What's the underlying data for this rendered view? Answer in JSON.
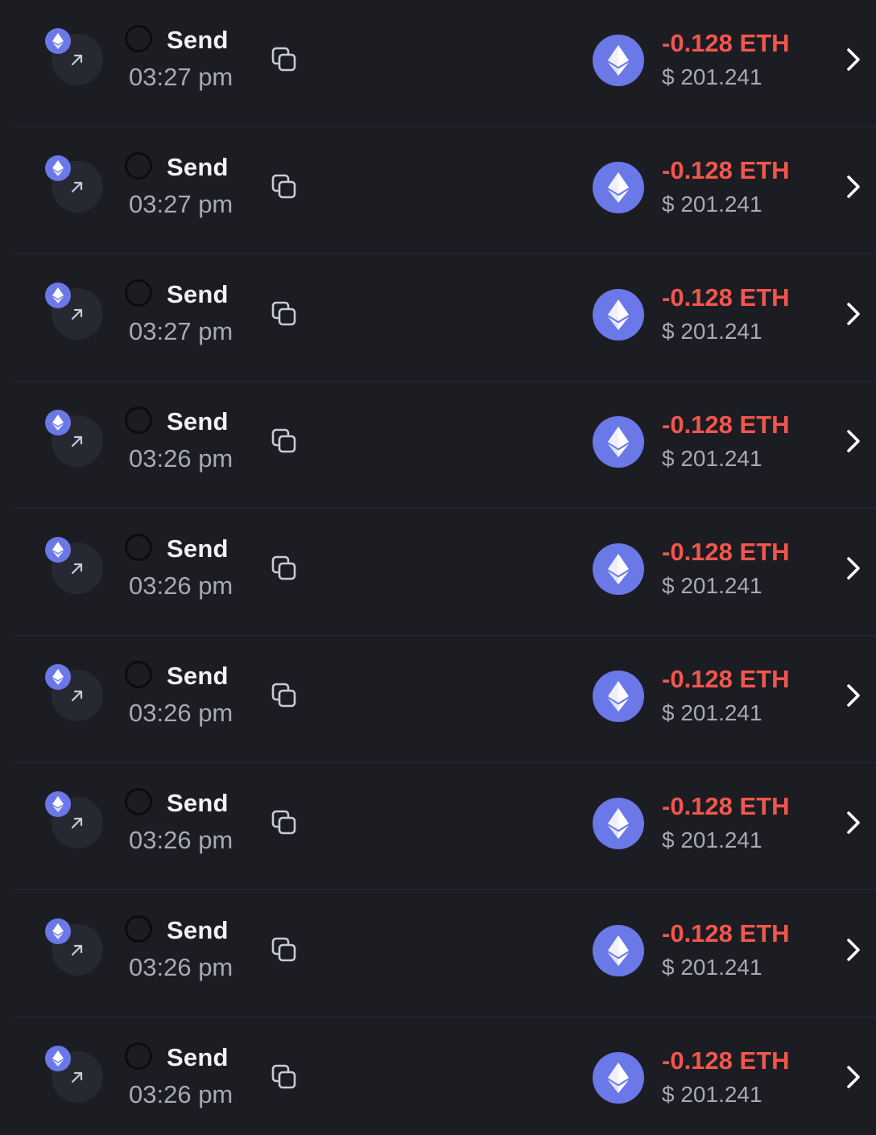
{
  "colors": {
    "background": "#1c1d23",
    "divider": "#262a36",
    "eth_blue": "#6a78e8",
    "negative_amount": "#f2564d",
    "muted_text": "#a7a9b3",
    "primary_text": "#f2f2f5"
  },
  "icons": {
    "direction": "arrow-up-right-icon",
    "chain": "ethereum-icon",
    "copy": "copy-icon",
    "status": "status-circle-icon",
    "navigate": "chevron-right-icon"
  },
  "transactions": [
    {
      "type": "Send",
      "time": "03:27 pm",
      "amount": "-0.128 ETH",
      "fiat": "$ 201.241"
    },
    {
      "type": "Send",
      "time": "03:27 pm",
      "amount": "-0.128 ETH",
      "fiat": "$ 201.241"
    },
    {
      "type": "Send",
      "time": "03:27 pm",
      "amount": "-0.128 ETH",
      "fiat": "$ 201.241"
    },
    {
      "type": "Send",
      "time": "03:26 pm",
      "amount": "-0.128 ETH",
      "fiat": "$ 201.241"
    },
    {
      "type": "Send",
      "time": "03:26 pm",
      "amount": "-0.128 ETH",
      "fiat": "$ 201.241"
    },
    {
      "type": "Send",
      "time": "03:26 pm",
      "amount": "-0.128 ETH",
      "fiat": "$ 201.241"
    },
    {
      "type": "Send",
      "time": "03:26 pm",
      "amount": "-0.128 ETH",
      "fiat": "$ 201.241"
    },
    {
      "type": "Send",
      "time": "03:26 pm",
      "amount": "-0.128 ETH",
      "fiat": "$ 201.241"
    },
    {
      "type": "Send",
      "time": "03:26 pm",
      "amount": "-0.128 ETH",
      "fiat": "$ 201.241"
    }
  ]
}
